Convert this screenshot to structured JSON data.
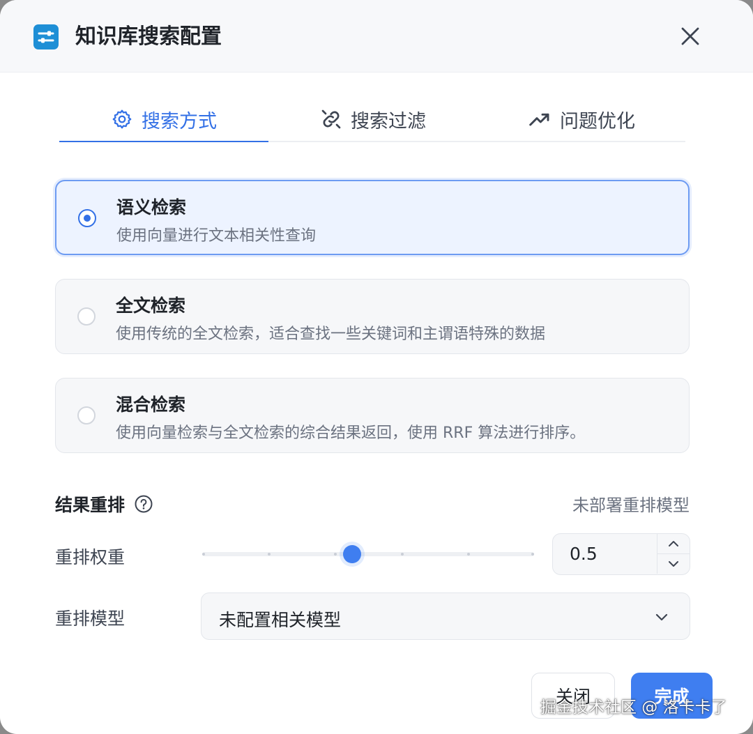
{
  "dialog": {
    "title": "知识库搜索配置",
    "header_icon": "sliders-icon",
    "close_icon": "close-icon"
  },
  "tabs": [
    {
      "label": "搜索方式",
      "icon": "gear-icon",
      "active": true
    },
    {
      "label": "搜索过滤",
      "icon": "link-icon",
      "active": false
    },
    {
      "label": "问题优化",
      "icon": "trending-up-icon",
      "active": false
    }
  ],
  "search_modes": [
    {
      "title": "语义检索",
      "description": "使用向量进行文本相关性查询",
      "selected": true
    },
    {
      "title": "全文检索",
      "description": "使用传统的全文检索，适合查找一些关键词和主谓语特殊的数据",
      "selected": false
    },
    {
      "title": "混合检索",
      "description": "使用向量检索与全文检索的综合结果返回，使用 RRF 算法进行排序。",
      "selected": false
    }
  ],
  "rerank": {
    "section_title": "结果重排",
    "status": "未部署重排模型",
    "weight_label": "重排权重",
    "weight_value": "0.5",
    "weight_fraction": 0.5,
    "model_label": "重排模型",
    "model_value": "未配置相关模型"
  },
  "footer": {
    "close_label": "关闭",
    "done_label": "完成"
  },
  "watermark": "掘金技术社区 @ 洛卡卡了",
  "colors": {
    "accent": "#3370e6",
    "primary_button": "#3f7ef0",
    "selected_bg": "#edf3ff"
  }
}
